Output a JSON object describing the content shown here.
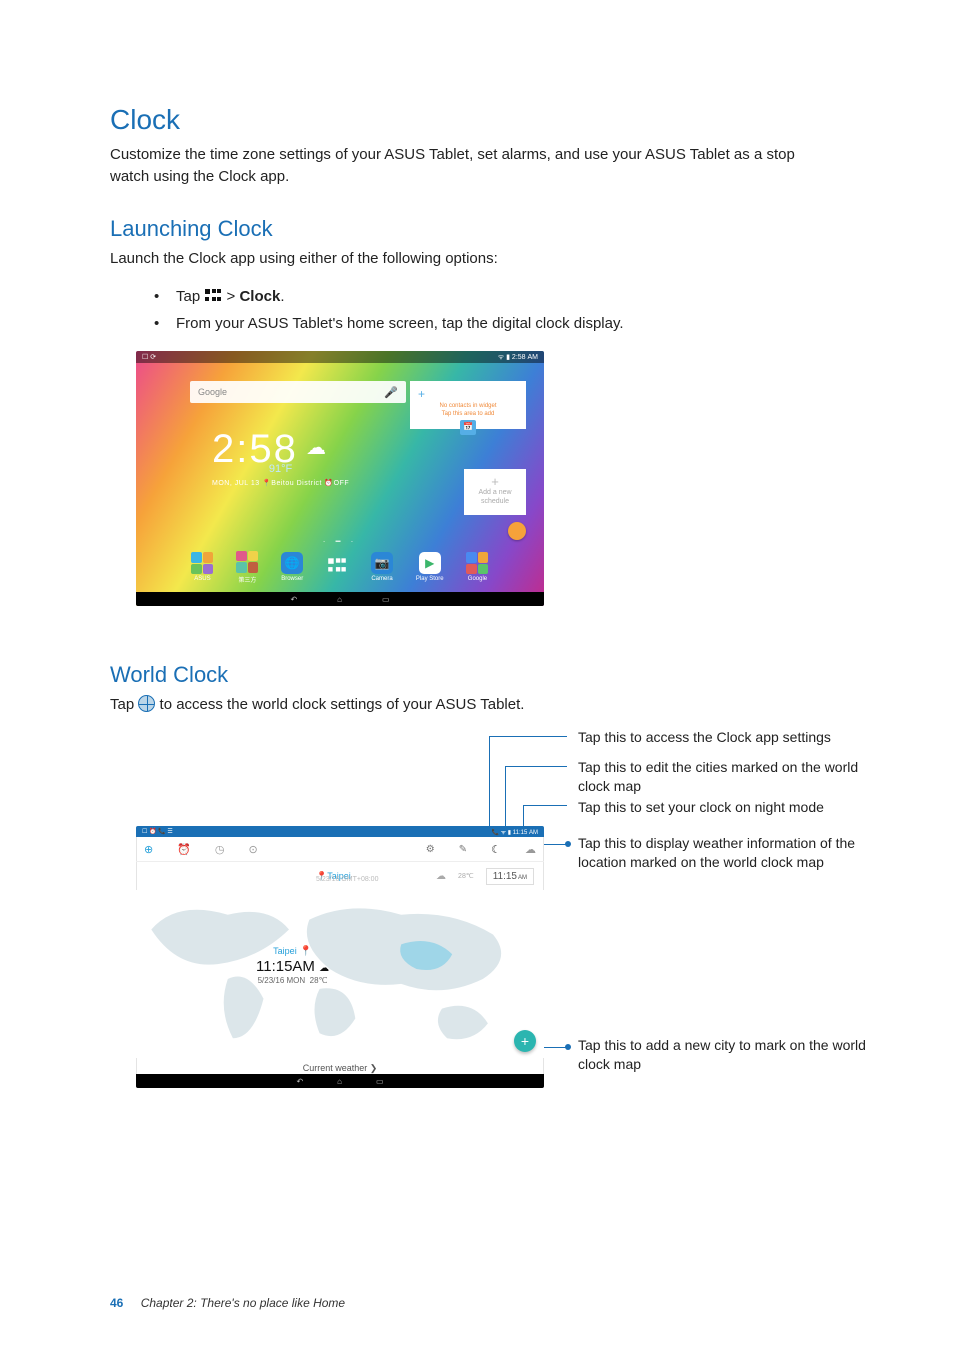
{
  "headings": {
    "clock": "Clock",
    "launching": "Launching Clock",
    "world": "World Clock"
  },
  "paras": {
    "intro": "Customize the time zone settings of your ASUS Tablet, set alarms, and use your ASUS Tablet as a stop watch using the Clock app.",
    "launch_intro": "Launch the Clock app using either of the following options:",
    "world_intro_a": "Tap ",
    "world_intro_b": " to access the world clock settings of your ASUS Tablet."
  },
  "bullets": {
    "tap_prefix": "Tap",
    "tap_mid": " > ",
    "tap_bold": "Clock",
    "tap_suffix": ".",
    "second": "From your ASUS Tablet's home screen, tap the digital clock display."
  },
  "home": {
    "status_left": "☐  ⟳",
    "status_right": "ᯤ  ▮ 2:58 AM",
    "search_hint": "Google",
    "mic": "🎤",
    "clock_time": "2:58",
    "weather_icon": "☁",
    "temp": "91°F",
    "date": "MON, JUL 13  📍Beitou District  ⏰OFF",
    "card1_line1": "No contacts in widget",
    "card1_line2": "Tap this area to add",
    "card1_cal": "📅",
    "card2_line": "Add a new schedule",
    "pager": "·  ━  ·",
    "dock": [
      {
        "label": "ASUS"
      },
      {
        "label": "第三方"
      },
      {
        "label": "Browser"
      },
      {
        "label": ""
      },
      {
        "label": "Camera"
      },
      {
        "label": "Play Store"
      },
      {
        "label": "Google"
      }
    ],
    "nav": {
      "back": "↶",
      "home": "⌂",
      "recent": "▭"
    }
  },
  "wc": {
    "status_left": "☐ ⏰ 📞 ☰",
    "status_right": "📞 ᯤ ▮ 11:15 AM",
    "tabs_icons": {
      "globe": "⊕",
      "alarm": "⏰",
      "stop": "◷",
      "timer": "⊙",
      "gear": "⚙",
      "pencil": "✎",
      "moon": "☾",
      "cloud": "☁"
    },
    "row": {
      "city": "Taipei",
      "gmt": "5/23/16  GMT+08:00",
      "temp": "28℃",
      "time": "11:15",
      "ampm": "AM"
    },
    "map_label": {
      "city": "Taipei",
      "pin": "📍",
      "time": "11:15AM",
      "w": "☁",
      "temp2": "28℃",
      "date": "5/23/16 MON"
    },
    "add": "+",
    "cw": "Current weather ❯",
    "nav": {
      "back": "↶",
      "home": "⌂",
      "recent": "▭"
    }
  },
  "callouts": {
    "c1": "Tap this to access the Clock app settings",
    "c2": "Tap this to edit the cities marked on the world clock map",
    "c3": "Tap this to set your clock on night mode",
    "c4": "Tap this to display weather information of the location marked on the world clock map",
    "c5": "Tap this to add a new city to mark on the world clock map"
  },
  "footer": {
    "page": "46",
    "chapter": "Chapter 2: There's no place like Home"
  }
}
